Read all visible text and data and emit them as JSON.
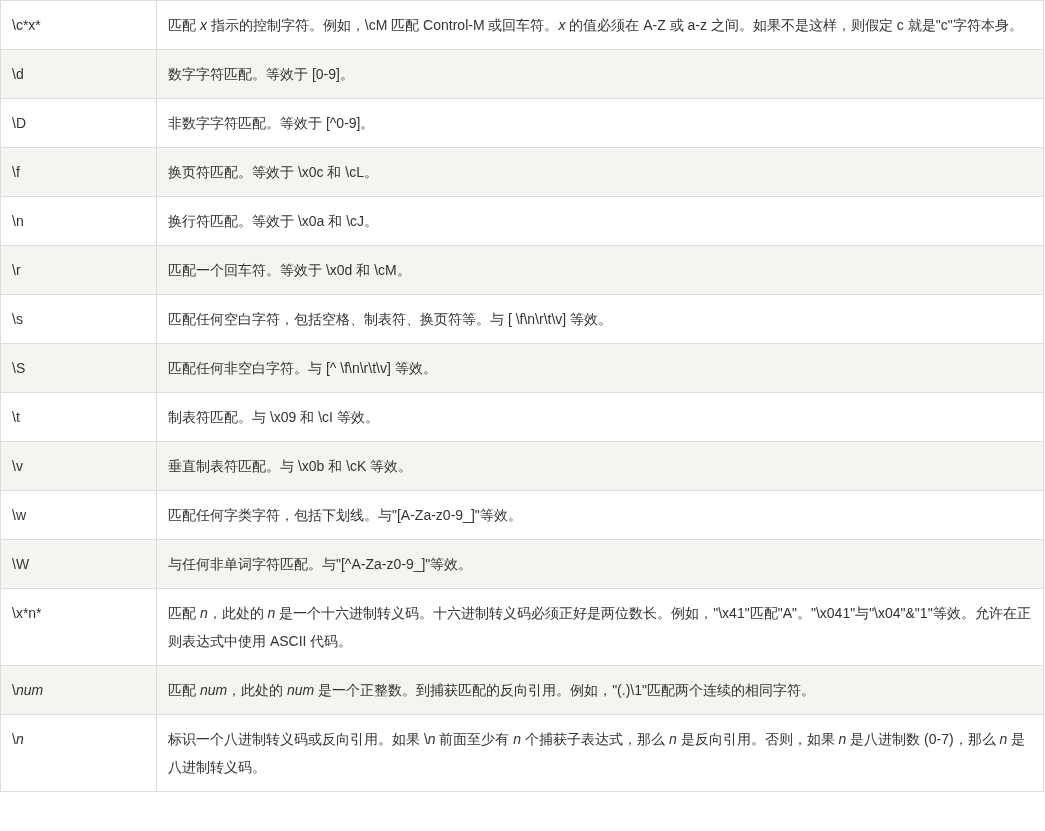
{
  "table": {
    "rows": [
      {
        "pattern": "\\c*x*",
        "description": "匹配 *x* 指示的控制字符。例如，\\cM 匹配 Control-M 或回车符。*x* 的值必须在 A-Z 或 a-z 之间。如果不是这样，则假定 c 就是\"c\"字符本身。"
      },
      {
        "pattern": "\\d",
        "description": "数字字符匹配。等效于 [0-9]。"
      },
      {
        "pattern": "\\D",
        "description": "非数字字符匹配。等效于 [^0-9]。"
      },
      {
        "pattern": "\\f",
        "description": "换页符匹配。等效于 \\x0c 和 \\cL。"
      },
      {
        "pattern": "\\n",
        "description": "换行符匹配。等效于 \\x0a 和 \\cJ。"
      },
      {
        "pattern": "\\r",
        "description": "匹配一个回车符。等效于 \\x0d 和 \\cM。"
      },
      {
        "pattern": "\\s",
        "description": "匹配任何空白字符，包括空格、制表符、换页符等。与 [ \\f\\n\\r\\t\\v] 等效。"
      },
      {
        "pattern": "\\S",
        "description": "匹配任何非空白字符。与 [^ \\f\\n\\r\\t\\v] 等效。"
      },
      {
        "pattern": "\\t",
        "description": "制表符匹配。与 \\x09 和 \\cI 等效。"
      },
      {
        "pattern": "\\v",
        "description": "垂直制表符匹配。与 \\x0b 和 \\cK 等效。"
      },
      {
        "pattern": "\\w",
        "description": "匹配任何字类字符，包括下划线。与\"[A-Za-z0-9_]\"等效。"
      },
      {
        "pattern": "\\W",
        "description": "与任何非单词字符匹配。与\"[^A-Za-z0-9_]\"等效。"
      },
      {
        "pattern": "\\x*n*",
        "description": "匹配 *n*，此处的 *n* 是一个十六进制转义码。十六进制转义码必须正好是两位数长。例如，\"\\x41\"匹配\"A\"。\"\\x041\"与\"\\x04\"&\"1\"等效。允许在正则表达式中使用 ASCII 代码。"
      },
      {
        "pattern": "\\*num*",
        "description": "匹配 *num*，此处的 *num* 是一个正整数。到捕获匹配的反向引用。例如，\"(.)\\1\"匹配两个连续的相同字符。"
      },
      {
        "pattern": "\\*n*",
        "description": "标识一个八进制转义码或反向引用。如果 \\*n* 前面至少有 *n* 个捕获子表达式，那么 *n* 是反向引用。否则，如果 *n* 是八进制数 (0-7)，那么 *n* 是八进制转义码。"
      }
    ]
  }
}
